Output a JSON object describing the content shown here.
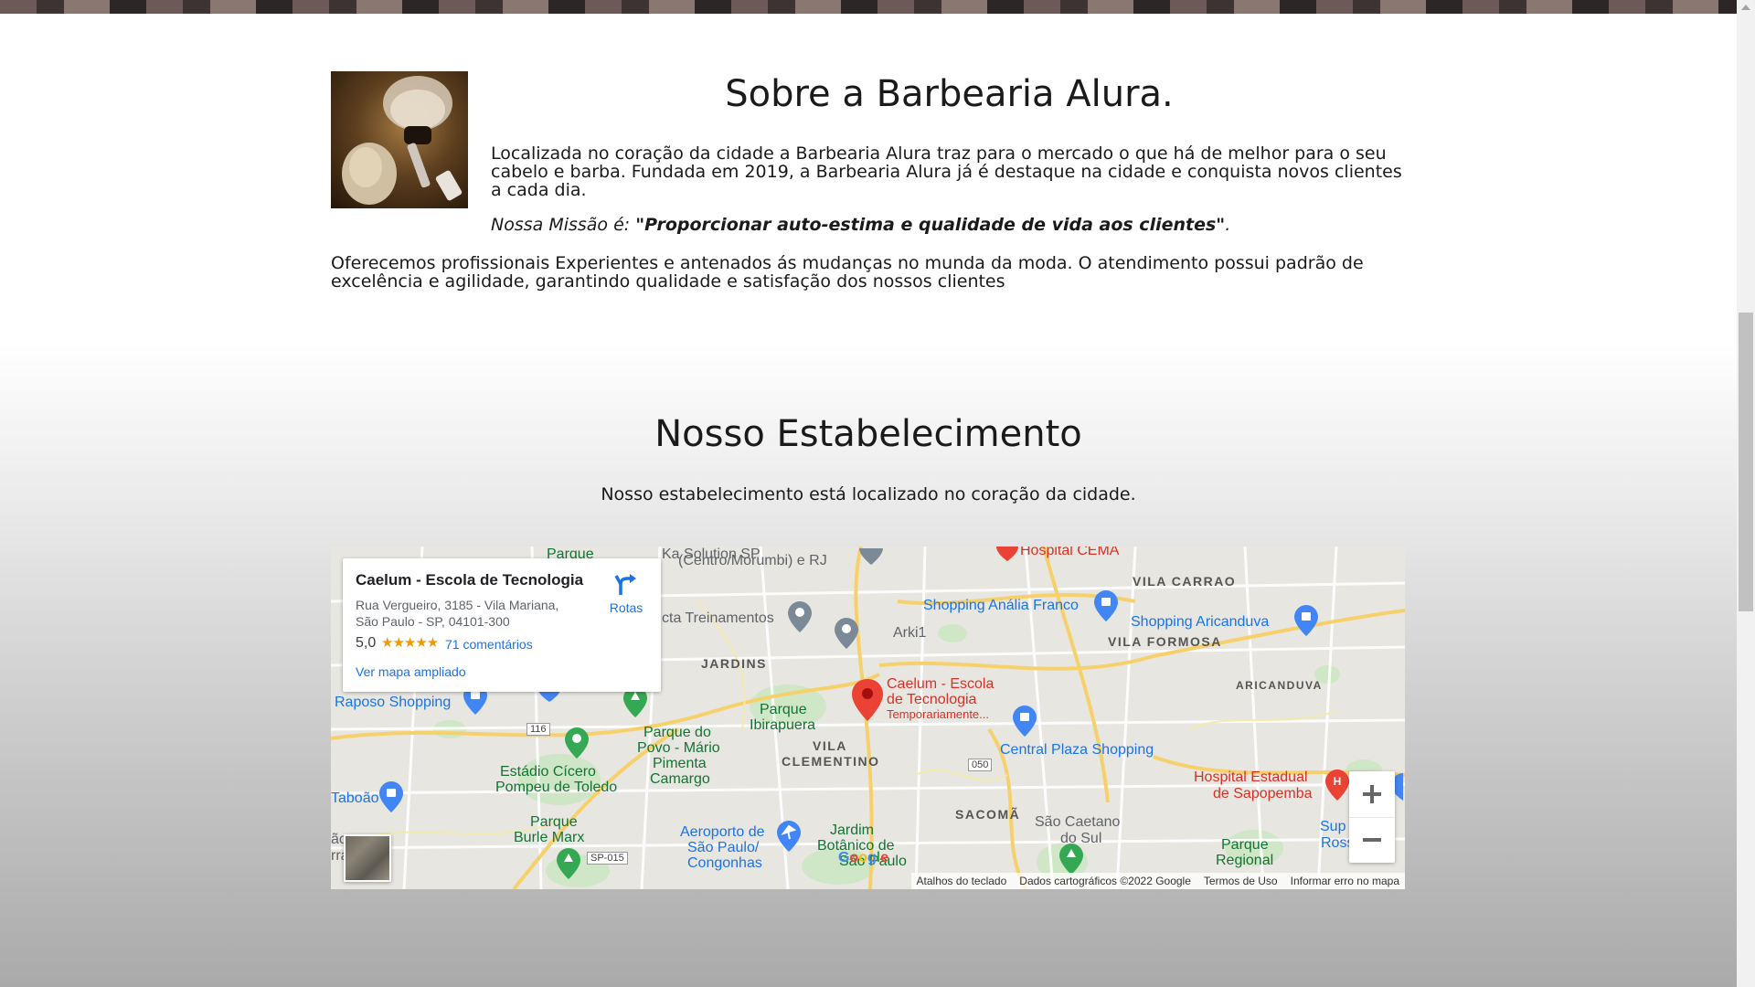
{
  "about": {
    "title": "Sobre a Barbearia Alura.",
    "image_icon": "shaving-brush-razor-image",
    "description": "Localizada no coração da cidade a Barbearia Alura traz para o mercado o que há de melhor para o seu cabelo e barba. Fundada em 2019, a Barbearia Alura já é destaque na cidade e conquista novos clientes a cada dia.",
    "mission_label": "Nossa Missão é: ",
    "mission_text": "\"Proporcionar auto-estima e qualidade de vida aos clientes\"",
    "mission_end": ".",
    "offer": "Oferecemos profissionais Experientes e antenados ás mudanças no munda da moda. O atendimento possui padrão de excelência e agilidade, garantindo qualidade e satisfação dos nossos clientes"
  },
  "establishment": {
    "title": "Nosso Estabelecimento",
    "text": "Nosso estabelecimento está localizado no coração da cidade."
  },
  "map": {
    "info_card": {
      "name": "Caelum - Escola de Tecnologia",
      "address_line1": "Rua Vergueiro, 3185 - Vila Mariana,",
      "address_line2": "São Paulo - SP, 04101-300",
      "rating": "5,0",
      "stars": "★★★★★",
      "reviews": "71 comentários",
      "view_bigger": "Ver mapa ampliado",
      "directions": "Rotas"
    },
    "labels": {
      "caelum_line1": "Caelum - Escola",
      "caelum_line2": "de Tecnologia",
      "caelum_line3": "Temporariamente...",
      "vila_carrao": "VILA CARRAO",
      "vila_formosa": "VILA FORMOSA",
      "aricanduva": "ARICANDUVA",
      "jardins": "JARDINS",
      "vila_clementino_1": "VILA",
      "vila_clementino_2": "CLEMENTINO",
      "sacoma": "SACOMÃ",
      "shopping_analia": "Shopping Anália Franco",
      "shopping_aricanduva": "Shopping Aricanduva",
      "central_plaza": "Central Plaza Shopping",
      "raposo": "Raposo Shopping",
      "ct_treinamentos": "cta Treinamentos",
      "arki1": "Arki1",
      "centro_morumbi_1": "Ka Solution SP",
      "centro_morumbi_2": "(Centro/Morumbi) e RJ",
      "hospital_cema": "Hospital CEMA",
      "hospital_sapopemba_1": "Hospital Estadual",
      "hospital_sapopemba_2": "de Sapopemba",
      "parque_ibirapuera_1": "Parque",
      "parque_ibirapuera_2": "Ibirapuera",
      "parque_povo_1": "Parque do",
      "parque_povo_2": "Povo - Mário",
      "parque_povo_3": "Pimenta",
      "parque_povo_4": "Camargo",
      "estadio_1": "Estádio Cícero",
      "estadio_2": "Pompeu de Toledo",
      "burle_marx_1": "Parque",
      "burle_marx_2": "Burle Marx",
      "aeroporto_1": "Aeroporto de",
      "aeroporto_2": "São Paulo/",
      "aeroporto_3": "Congonhas",
      "jardim_botanico_1": "Jardim",
      "jardim_botanico_2": "Botânico de",
      "jardim_botanico_3": "São Paulo",
      "sao_caetano_1": "São Caetano",
      "sao_caetano_2": "do Sul",
      "parque_regional_1": "Parque",
      "parque_regional_2": "Regional",
      "taboao": "Taboão",
      "sup_rossi_1": "Sup",
      "sup_rossi_2": "Rossi - S",
      "road_116": "116",
      "road_050": "050",
      "road_sp015": "SP-015",
      "parque_top": "Parque",
      "left_edge_1": "ão",
      "left_edge_2": "rra"
    },
    "google_logo": [
      "G",
      "o",
      "o",
      "g",
      "l",
      "e"
    ],
    "attribution": {
      "keyboard": "Atalhos do teclado",
      "map_data": "Dados cartográficos ©2022 Google",
      "terms": "Termos de Uso",
      "report": "Informar erro no mapa"
    },
    "colors": {
      "pin_red": "#ea4335",
      "link_blue": "#1a73e8",
      "road_yellow": "#f6d16b",
      "park_green": "#cde7c4"
    }
  }
}
